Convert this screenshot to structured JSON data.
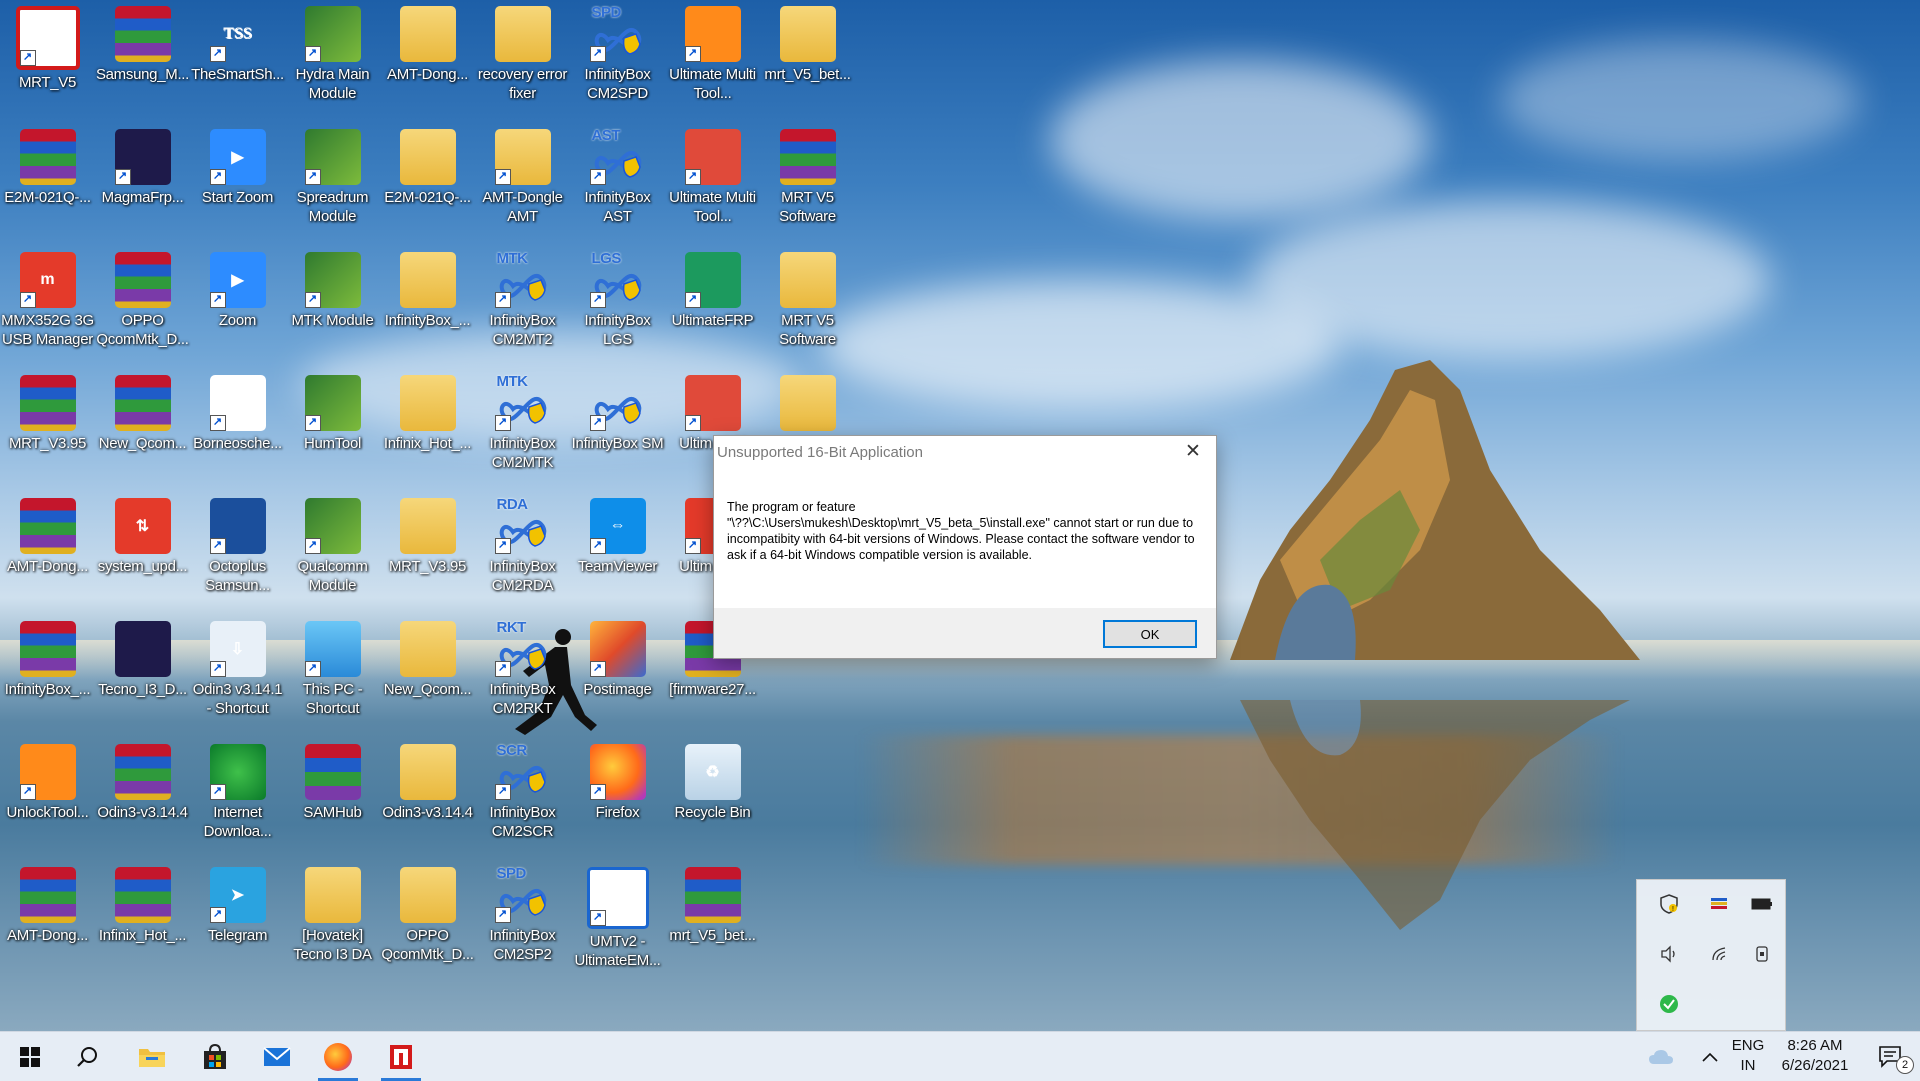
{
  "desktop": {
    "icons": [
      {
        "id": "mrt-v5",
        "label": "MRT_V5",
        "style": "i-mrt",
        "glyph": "⊓",
        "col": 0,
        "row": 0,
        "shortcut": true
      },
      {
        "id": "samsung-m",
        "label": "Samsung_M...",
        "style": "i-winrar",
        "glyph": "",
        "col": 1,
        "row": 0,
        "shortcut": false
      },
      {
        "id": "thesmartsh",
        "label": "TheSmartSh...",
        "style": "i-tss",
        "glyph": "TSS",
        "col": 2,
        "row": 0,
        "shortcut": true
      },
      {
        "id": "hydra-main",
        "label": "Hydra Main Module",
        "style": "i-dragon",
        "glyph": "",
        "col": 3,
        "row": 0,
        "shortcut": true
      },
      {
        "id": "amt-dong-1",
        "label": "AMT-Dong...",
        "style": "i-folder-doc",
        "glyph": "",
        "col": 4,
        "row": 0,
        "shortcut": false
      },
      {
        "id": "recovery-error",
        "label": "recovery error fixer",
        "style": "i-folder",
        "glyph": "",
        "col": 5,
        "row": 0,
        "shortcut": false
      },
      {
        "id": "infinitybox-cm2spd",
        "label": "InfinityBox CM2SPD",
        "style": "i-infinity",
        "glyph": "SPD",
        "col": 6,
        "row": 0,
        "shortcut": true
      },
      {
        "id": "ultimate-multi-1",
        "label": "Ultimate Multi Tool...",
        "style": "i-orange-round",
        "glyph": "",
        "col": 7,
        "row": 0,
        "shortcut": true
      },
      {
        "id": "mrt-v5-bet-1",
        "label": "mrt_V5_bet...",
        "style": "i-folder-doc",
        "glyph": "",
        "col": 8,
        "row": 0,
        "shortcut": false
      },
      {
        "id": "e2m-021q-1",
        "label": "E2M-021Q-...",
        "style": "i-winrar",
        "glyph": "",
        "col": 0,
        "row": 1,
        "shortcut": false
      },
      {
        "id": "magmafrp",
        "label": "MagmaFrp...",
        "style": "i-dark",
        "glyph": "",
        "col": 1,
        "row": 1,
        "shortcut": true
      },
      {
        "id": "start-zoom",
        "label": "Start Zoom",
        "style": "i-zoom",
        "glyph": "▶",
        "col": 2,
        "row": 1,
        "shortcut": true
      },
      {
        "id": "spreadrum",
        "label": "Spreadrum Module",
        "style": "i-dragon",
        "glyph": "",
        "col": 3,
        "row": 1,
        "shortcut": true
      },
      {
        "id": "e2m-021q-2",
        "label": "E2M-021Q-...",
        "style": "i-folder",
        "glyph": "",
        "col": 4,
        "row": 1,
        "shortcut": false
      },
      {
        "id": "amt-dongle-amt",
        "label": "AMT-Dongle AMT",
        "style": "i-folder-doc",
        "glyph": "",
        "col": 5,
        "row": 1,
        "shortcut": true
      },
      {
        "id": "infinitybox-ast",
        "label": "InfinityBox AST",
        "style": "i-infinity",
        "glyph": "AST",
        "col": 6,
        "row": 1,
        "shortcut": true
      },
      {
        "id": "ultimate-multi-2",
        "label": "Ultimate Multi Tool...",
        "style": "i-ultimate",
        "glyph": "",
        "col": 7,
        "row": 1,
        "shortcut": true
      },
      {
        "id": "mrt-v5-software-1",
        "label": "MRT V5 Software",
        "style": "i-winrar",
        "glyph": "",
        "col": 8,
        "row": 1,
        "shortcut": false
      },
      {
        "id": "mmx352g",
        "label": "MMX352G 3G USB Manager",
        "style": "i-red-round",
        "glyph": "m",
        "col": 0,
        "row": 2,
        "shortcut": true
      },
      {
        "id": "oppo-qcommtk-1",
        "label": "OPPO QcomMtk_D...",
        "style": "i-winrar",
        "glyph": "",
        "col": 1,
        "row": 2,
        "shortcut": false
      },
      {
        "id": "zoom",
        "label": "Zoom",
        "style": "i-zoom",
        "glyph": "▶",
        "col": 2,
        "row": 2,
        "shortcut": true
      },
      {
        "id": "mtk-module",
        "label": "MTK Module",
        "style": "i-dragon",
        "glyph": "",
        "col": 3,
        "row": 2,
        "shortcut": true
      },
      {
        "id": "infinitybox-folder",
        "label": "InfinityBox_...",
        "style": "i-folder-doc",
        "glyph": "",
        "col": 4,
        "row": 2,
        "shortcut": false
      },
      {
        "id": "infinitybox-cm2mt2",
        "label": "InfinityBox CM2MT2",
        "style": "i-infinity",
        "glyph": "MTK",
        "col": 5,
        "row": 2,
        "shortcut": true
      },
      {
        "id": "infinitybox-lgs",
        "label": "InfinityBox LGS",
        "style": "i-infinity",
        "glyph": "LGS",
        "col": 6,
        "row": 2,
        "shortcut": true
      },
      {
        "id": "ultimatefrp",
        "label": "UltimateFRP",
        "style": "i-green-round",
        "glyph": "",
        "col": 7,
        "row": 2,
        "shortcut": true
      },
      {
        "id": "mrt-v5-software-2",
        "label": "MRT V5 Software",
        "style": "i-folder-doc",
        "glyph": "",
        "col": 8,
        "row": 2,
        "shortcut": false
      },
      {
        "id": "mrt-v395-1",
        "label": "MRT_V3.95",
        "style": "i-winrar",
        "glyph": "",
        "col": 0,
        "row": 3,
        "shortcut": false
      },
      {
        "id": "new-qcom-1",
        "label": "New_Qcom...",
        "style": "i-winrar",
        "glyph": "",
        "col": 1,
        "row": 3,
        "shortcut": false
      },
      {
        "id": "borneosche",
        "label": "Borneosche...",
        "style": "i-borneo",
        "glyph": "B",
        "col": 2,
        "row": 3,
        "shortcut": true
      },
      {
        "id": "humtool",
        "label": "HumTool",
        "style": "i-dragon",
        "glyph": "",
        "col": 3,
        "row": 3,
        "shortcut": true
      },
      {
        "id": "infinix-hot-1",
        "label": "Infinix_Hot_...",
        "style": "i-folder-doc",
        "glyph": "",
        "col": 4,
        "row": 3,
        "shortcut": false
      },
      {
        "id": "infinitybox-cm2mtk",
        "label": "InfinityBox CM2MTK",
        "style": "i-infinity",
        "glyph": "MTK",
        "col": 5,
        "row": 3,
        "shortcut": true
      },
      {
        "id": "infinitybox-sm",
        "label": "InfinityBox SM",
        "style": "i-infinity",
        "glyph": "",
        "col": 6,
        "row": 3,
        "shortcut": true
      },
      {
        "id": "ultim-multi-3",
        "label": "Ultim Multi",
        "style": "i-ultimate",
        "glyph": "",
        "col": 7,
        "row": 3,
        "shortcut": true
      },
      {
        "id": "folder-r3c8",
        "label": "",
        "style": "i-folder",
        "glyph": "",
        "col": 8,
        "row": 3,
        "shortcut": false
      },
      {
        "id": "amt-dong-2",
        "label": "AMT-Dong...",
        "style": "i-winrar",
        "glyph": "",
        "col": 0,
        "row": 4,
        "shortcut": false
      },
      {
        "id": "system-upd",
        "label": "system_upd...",
        "style": "i-red-round",
        "glyph": "⇅",
        "col": 1,
        "row": 4,
        "shortcut": false
      },
      {
        "id": "octoplus",
        "label": "Octoplus Samsun...",
        "style": "i-octopus",
        "glyph": "",
        "col": 2,
        "row": 4,
        "shortcut": true
      },
      {
        "id": "qualcomm-module",
        "label": "Qualcomm Module",
        "style": "i-dragon",
        "glyph": "",
        "col": 3,
        "row": 4,
        "shortcut": true
      },
      {
        "id": "mrt-v395-2",
        "label": "MRT_V3.95",
        "style": "i-folder-doc",
        "glyph": "",
        "col": 4,
        "row": 4,
        "shortcut": false
      },
      {
        "id": "infinitybox-cm2rda",
        "label": "InfinityBox CM2RDA",
        "style": "i-infinity",
        "glyph": "RDA",
        "col": 5,
        "row": 4,
        "shortcut": true
      },
      {
        "id": "teamviewer",
        "label": "TeamViewer",
        "style": "i-teamviewer",
        "glyph": "⇔",
        "col": 6,
        "row": 4,
        "shortcut": true
      },
      {
        "id": "ultim-multi-4",
        "label": "Ultim Multi",
        "style": "i-red-round",
        "glyph": "",
        "col": 7,
        "row": 4,
        "shortcut": true
      },
      {
        "id": "infinitybox-2",
        "label": "InfinityBox_...",
        "style": "i-winrar",
        "glyph": "",
        "col": 0,
        "row": 5,
        "shortcut": false
      },
      {
        "id": "tecno-i3-d",
        "label": "Tecno_I3_D...",
        "style": "i-dark",
        "glyph": "",
        "col": 1,
        "row": 5,
        "shortcut": false
      },
      {
        "id": "odin3-shortcut",
        "label": "Odin3 v3.14.1 - Shortcut",
        "style": "i-odin",
        "glyph": "⇩",
        "col": 2,
        "row": 5,
        "shortcut": true
      },
      {
        "id": "this-pc",
        "label": "This PC - Shortcut",
        "style": "i-pc",
        "glyph": "",
        "col": 3,
        "row": 5,
        "shortcut": true
      },
      {
        "id": "new-qcom-2",
        "label": "New_Qcom...",
        "style": "i-folder-doc",
        "glyph": "",
        "col": 4,
        "row": 5,
        "shortcut": false
      },
      {
        "id": "infinitybox-cm2rkt",
        "label": "InfinityBox CM2RKT",
        "style": "i-infinity",
        "glyph": "RKT",
        "col": 5,
        "row": 5,
        "shortcut": true
      },
      {
        "id": "postimage",
        "label": "Postimage",
        "style": "i-postimage",
        "glyph": "",
        "col": 6,
        "row": 5,
        "shortcut": true
      },
      {
        "id": "firmware27",
        "label": "[firmware27...",
        "style": "i-winrar",
        "glyph": "",
        "col": 7,
        "row": 5,
        "shortcut": false
      },
      {
        "id": "unlocktool",
        "label": "UnlockTool...",
        "style": "i-orange-round",
        "glyph": "",
        "col": 0,
        "row": 6,
        "shortcut": true
      },
      {
        "id": "odin3-v3144-1",
        "label": "Odin3-v3.14.4",
        "style": "i-winrar",
        "glyph": "",
        "col": 1,
        "row": 6,
        "shortcut": false
      },
      {
        "id": "idm",
        "label": "Internet Downloa...",
        "style": "i-idm",
        "glyph": "",
        "col": 2,
        "row": 6,
        "shortcut": true
      },
      {
        "id": "samhub",
        "label": "SAMHub",
        "style": "i-samhub",
        "glyph": "",
        "col": 3,
        "row": 6,
        "shortcut": false
      },
      {
        "id": "odin3-v3144-2",
        "label": "Odin3-v3.14.4",
        "style": "i-folder",
        "glyph": "",
        "col": 4,
        "row": 6,
        "shortcut": false
      },
      {
        "id": "infinitybox-cm2scr",
        "label": "InfinityBox CM2SCR",
        "style": "i-infinity",
        "glyph": "SCR",
        "col": 5,
        "row": 6,
        "shortcut": true
      },
      {
        "id": "firefox",
        "label": "Firefox",
        "style": "i-firefox",
        "glyph": "",
        "col": 6,
        "row": 6,
        "shortcut": true
      },
      {
        "id": "recycle-bin",
        "label": "Recycle Bin",
        "style": "i-recycle",
        "glyph": "♻",
        "col": 7,
        "row": 6,
        "shortcut": false
      },
      {
        "id": "amt-dong-3",
        "label": "AMT-Dong...",
        "style": "i-winrar",
        "glyph": "",
        "col": 0,
        "row": 7,
        "shortcut": false
      },
      {
        "id": "infinix-hot-2",
        "label": "Infinix_Hot_...",
        "style": "i-winrar",
        "glyph": "",
        "col": 1,
        "row": 7,
        "shortcut": false
      },
      {
        "id": "telegram",
        "label": "Telegram",
        "style": "i-telegram",
        "glyph": "➤",
        "col": 2,
        "row": 7,
        "shortcut": true
      },
      {
        "id": "hovatek-tecno",
        "label": "[Hovatek] Tecno I3 DA",
        "style": "i-folder",
        "glyph": "",
        "col": 3,
        "row": 7,
        "shortcut": false
      },
      {
        "id": "oppo-qcommtk-2",
        "label": "OPPO QcomMtk_D...",
        "style": "i-folder-doc",
        "glyph": "",
        "col": 4,
        "row": 7,
        "shortcut": false
      },
      {
        "id": "infinitybox-cm2sp2",
        "label": "InfinityBox CM2SP2",
        "style": "i-infinity",
        "glyph": "SPD",
        "col": 5,
        "row": 7,
        "shortcut": true
      },
      {
        "id": "umtv2",
        "label": "UMTv2 - UltimateEM...",
        "style": "i-umt",
        "glyph": "",
        "col": 6,
        "row": 7,
        "shortcut": true
      },
      {
        "id": "mrt-v5-bet-2",
        "label": "mrt_V5_bet...",
        "style": "i-winrar",
        "glyph": "",
        "col": 7,
        "row": 7,
        "shortcut": false
      }
    ]
  },
  "dialog": {
    "title": "Unsupported 16-Bit Application",
    "message_line1": "The program or feature",
    "message_line2": "\"\\??\\C:\\Users\\mukesh\\Desktop\\mrt_V5_beta_5\\install.exe\" cannot start or run due to incompatibity with 64-bit versions of Windows. Please contact the software vendor to ask if a 64-bit Windows compatible version is available.",
    "ok_label": "OK",
    "close_glyph": "✕"
  },
  "tray_popup": {
    "icons": [
      "defender-warning-icon",
      "color-flag-icon",
      "battery-icon",
      "volume-icon",
      "wifi-icon",
      "phone-link-icon",
      "green-check-icon"
    ]
  },
  "taskbar": {
    "language_line1": "ENG",
    "language_line2": "IN",
    "time": "8:26 AM",
    "date": "6/26/2021",
    "notification_count": "2",
    "apps": [
      "start",
      "search",
      "file-explorer",
      "microsoft-store",
      "mail",
      "firefox",
      "mrt"
    ],
    "accent": "#2a7ad8"
  }
}
